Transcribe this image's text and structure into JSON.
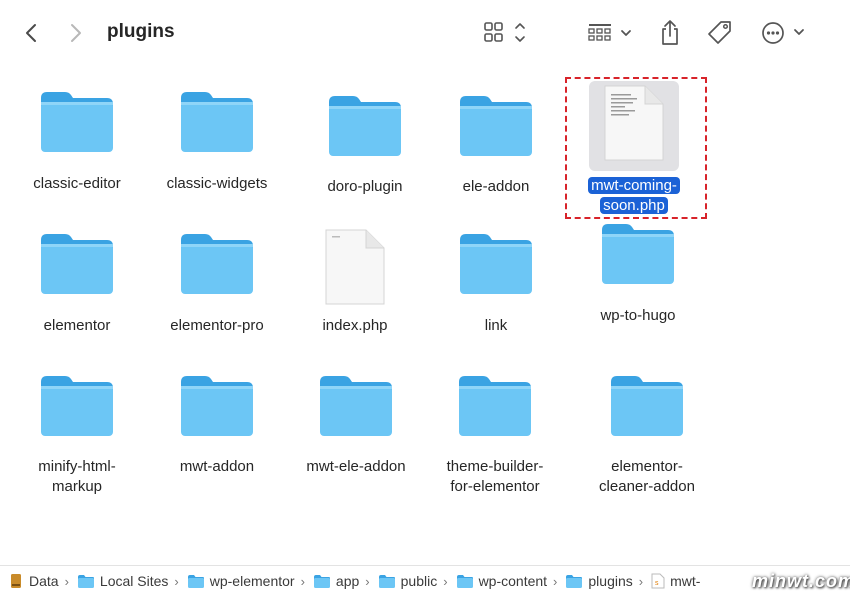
{
  "window": {
    "title": "plugins",
    "toolbar": {
      "back": "back-icon",
      "forward": "forward-icon",
      "view_mode": "icon-grid-icon",
      "group": "group-grid-icon",
      "share": "share-icon",
      "tags": "tag-icon",
      "more": "more-icon"
    }
  },
  "items": [
    {
      "label": "classic-editor",
      "kind": "folder"
    },
    {
      "label": "classic-widgets",
      "kind": "folder"
    },
    {
      "label": "doro-plugin",
      "kind": "folder"
    },
    {
      "label": "ele-addon",
      "kind": "folder"
    },
    {
      "label": "mwt-coming-\nsoon.php",
      "kind": "file",
      "selected": true
    },
    {
      "label": "elementor",
      "kind": "folder"
    },
    {
      "label": "elementor-pro",
      "kind": "folder"
    },
    {
      "label": "index.php",
      "kind": "file"
    },
    {
      "label": "link",
      "kind": "folder"
    },
    {
      "label": "wp-to-hugo",
      "kind": "folder"
    },
    {
      "label": "minify-html-\nmarkup",
      "kind": "folder"
    },
    {
      "label": "mwt-addon",
      "kind": "folder"
    },
    {
      "label": "mwt-ele-addon",
      "kind": "folder"
    },
    {
      "label": "theme-builder-\nfor-elementor",
      "kind": "folder"
    },
    {
      "label": "elementor-\ncleaner-addon",
      "kind": "folder"
    }
  ],
  "pathbar": [
    {
      "label": "Data",
      "icon": "drive-icon"
    },
    {
      "label": "Local Sites",
      "icon": "folder-icon"
    },
    {
      "label": "wp-elementor",
      "icon": "folder-icon"
    },
    {
      "label": "app",
      "icon": "folder-icon"
    },
    {
      "label": "public",
      "icon": "folder-icon"
    },
    {
      "label": "wp-content",
      "icon": "folder-icon"
    },
    {
      "label": "plugins",
      "icon": "folder-icon"
    },
    {
      "label": "mwt-",
      "icon": "php-file-icon"
    }
  ],
  "watermark": "minwt.com",
  "colors": {
    "folder": "#6cc6f5",
    "folder_tab": "#3aa3e3",
    "selection": "#1b62d6",
    "highlight_box": "#d8232a"
  }
}
